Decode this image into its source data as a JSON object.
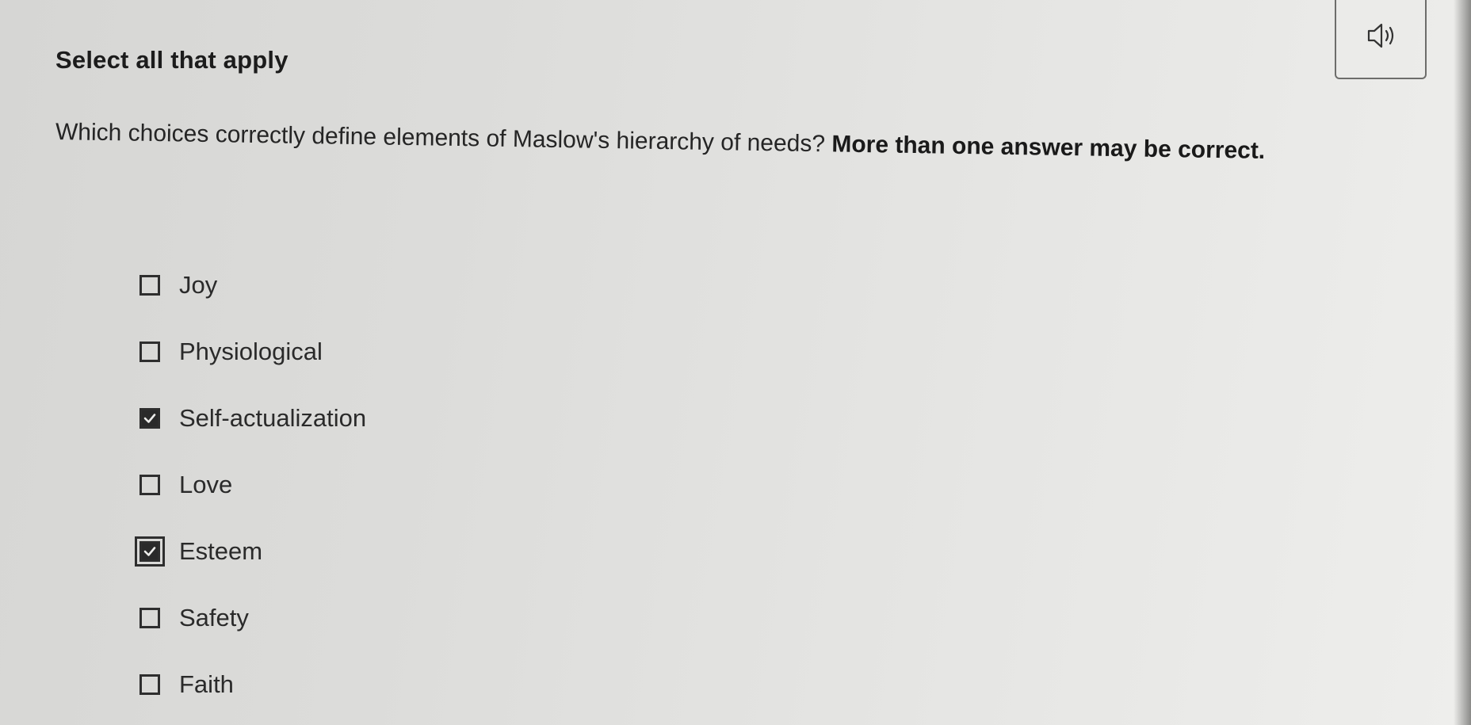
{
  "header": {
    "title": "Select all that apply"
  },
  "audio": {
    "icon": "speaker-icon"
  },
  "question": {
    "text": "Which choices correctly define elements of Maslow's hierarchy of needs? ",
    "emphasis": "More than one answer may be correct."
  },
  "options": [
    {
      "label": "Joy",
      "checked": false
    },
    {
      "label": "Physiological",
      "checked": false
    },
    {
      "label": "Self-actualization",
      "checked": true
    },
    {
      "label": "Love",
      "checked": false
    },
    {
      "label": "Esteem",
      "checked": true,
      "focused": true
    },
    {
      "label": "Safety",
      "checked": false
    },
    {
      "label": "Faith",
      "checked": false
    }
  ],
  "colors": {
    "check_fill": "#2a2a2a",
    "text": "#2a2a2a"
  }
}
